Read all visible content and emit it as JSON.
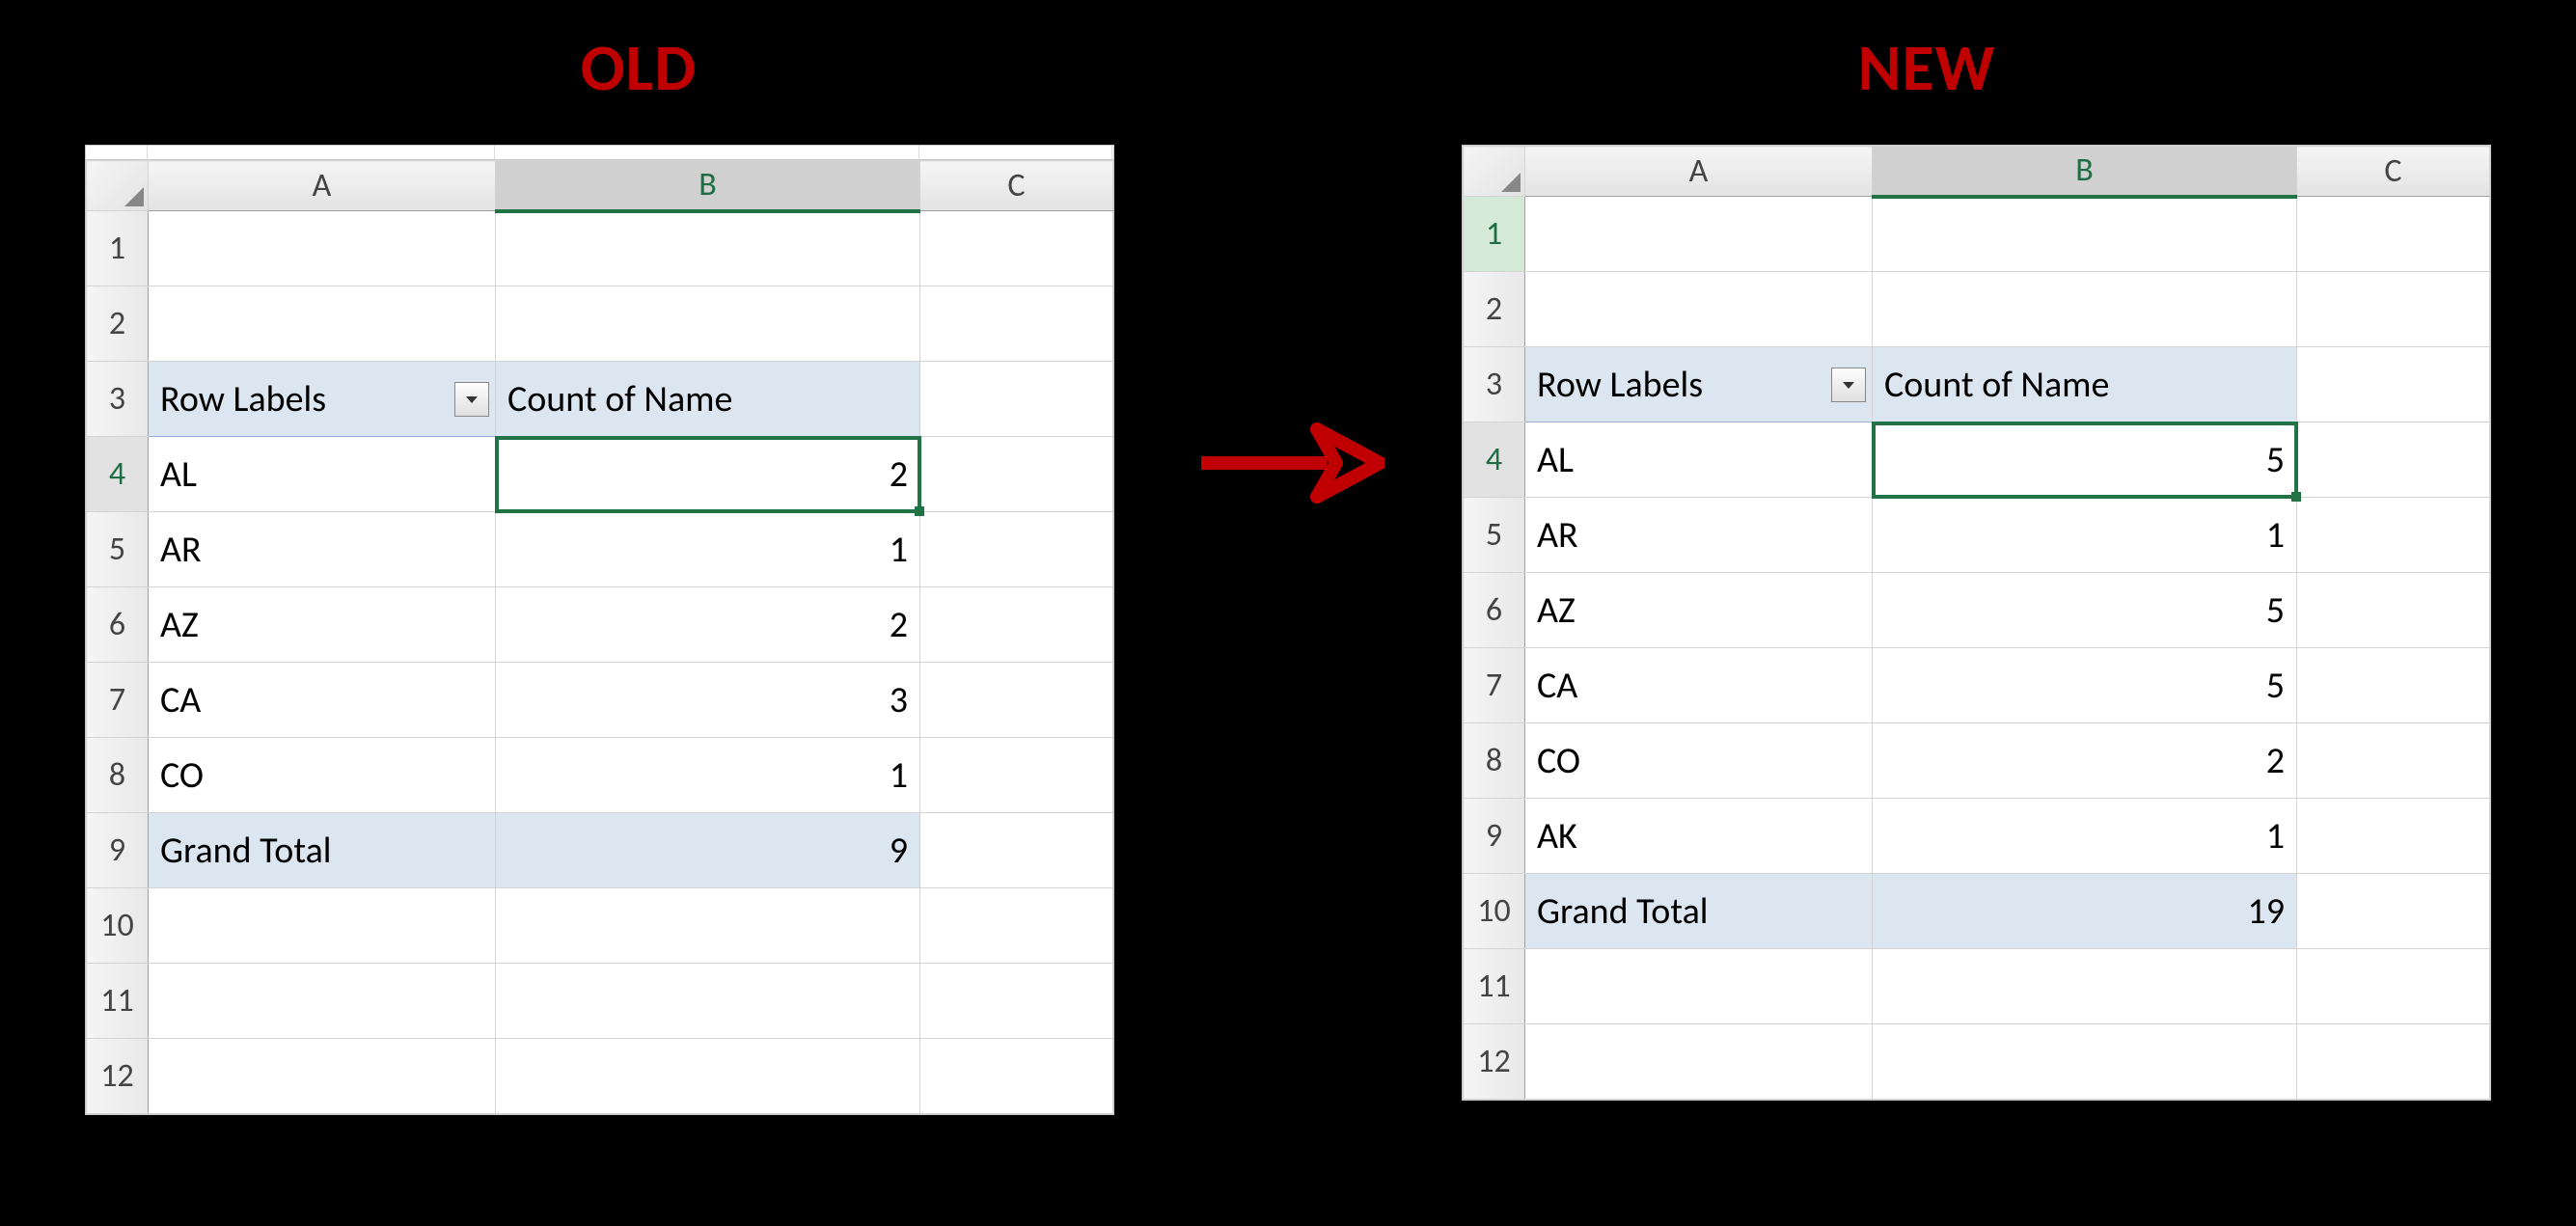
{
  "titles": {
    "old": "OLD",
    "new": "NEW"
  },
  "columns": [
    "A",
    "B",
    "C"
  ],
  "old": {
    "rows": [
      "1",
      "2",
      "3",
      "4",
      "5",
      "6",
      "7",
      "8",
      "9",
      "10",
      "11",
      "12"
    ],
    "selected_row_header": "4",
    "selected_col_header": "B",
    "pivot": {
      "row_label_header": "Row Labels",
      "value_header": "Count of Name",
      "rows": [
        {
          "label": "AL",
          "value": "2"
        },
        {
          "label": "AR",
          "value": "1"
        },
        {
          "label": "AZ",
          "value": "2"
        },
        {
          "label": "CA",
          "value": "3"
        },
        {
          "label": "CO",
          "value": "1"
        }
      ],
      "grand_total_label": "Grand Total",
      "grand_total_value": "9"
    }
  },
  "new": {
    "rows": [
      "1",
      "2",
      "3",
      "4",
      "5",
      "6",
      "7",
      "8",
      "9",
      "10",
      "11",
      "12"
    ],
    "selected_row_header_green": "1",
    "selected_row_header": "4",
    "selected_col_header": "B",
    "pivot": {
      "row_label_header": "Row Labels",
      "value_header": "Count of Name",
      "rows": [
        {
          "label": "AL",
          "value": "5"
        },
        {
          "label": "AR",
          "value": "1"
        },
        {
          "label": "AZ",
          "value": "5"
        },
        {
          "label": "CA",
          "value": "5"
        },
        {
          "label": "CO",
          "value": "2"
        },
        {
          "label": "AK",
          "value": "1"
        }
      ],
      "grand_total_label": "Grand Total",
      "grand_total_value": "19"
    }
  }
}
